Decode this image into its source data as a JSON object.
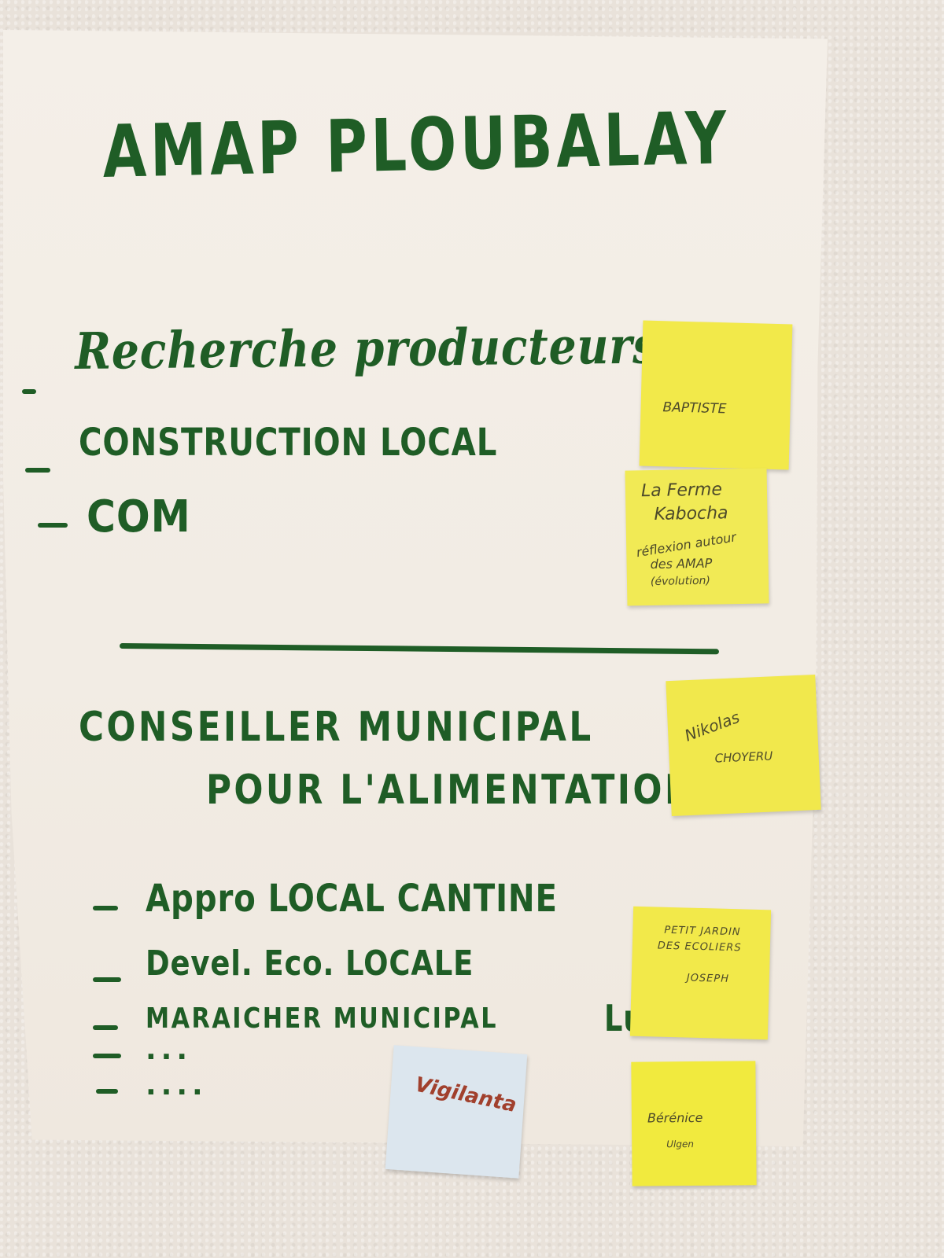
{
  "flipchart": {
    "title": "AMAP PLOUBALAY",
    "items_top": [
      "Recherche producteurs.",
      "CONSTRUCTION LOCAL",
      "COM"
    ],
    "heading_line1": "CONSEILLER MUNICIPAL",
    "heading_line2": "POUR L'ALIMENTATION",
    "items_bottom": [
      "Appro LOCAL CANTINE",
      "Devel. Eco. LOCALE",
      "MARAICHER MUNICIPAL",
      "...",
      "...."
    ],
    "side_mark": "Lu"
  },
  "sticky_notes": [
    {
      "lines": [
        "BAPTISTE"
      ],
      "color": "#f2e94a"
    },
    {
      "lines": [
        "La Ferme",
        "Kabocha",
        "réflexion autour",
        "des AMAP",
        "(évolution)"
      ],
      "color": "#f1ea55"
    },
    {
      "lines": [
        "Nikolas",
        "CHOYERU"
      ],
      "color": "#f1e84c"
    },
    {
      "lines": [
        "PETIT JARDIN",
        "DES ECOLIERS",
        "JOSEPH"
      ],
      "color": "#f2e94a"
    },
    {
      "lines": [
        "Bérénice",
        "Ulgen"
      ],
      "color": "#f1ea3e"
    },
    {
      "lines": [
        "Vigilanta"
      ],
      "color": "#dce6ee"
    }
  ]
}
